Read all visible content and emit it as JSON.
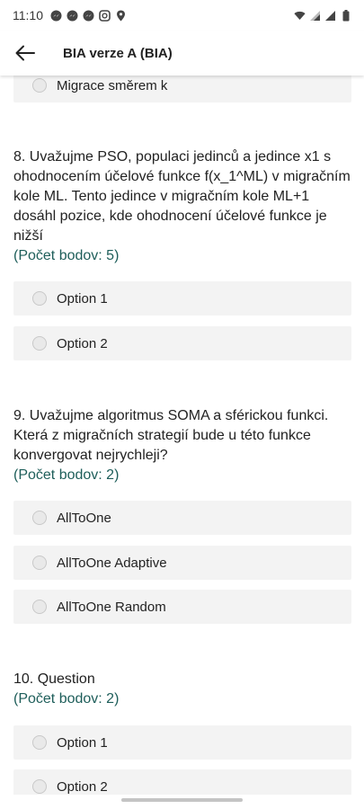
{
  "status": {
    "time": "11:10"
  },
  "app_bar": {
    "title": "BIA verze A (BIA)"
  },
  "partial_option": {
    "label": "Migrace směrem k"
  },
  "questions": [
    {
      "text": "8. Uvažujme PSO, populaci jedinců a jedince x1 s ohodnocením účelové funkce f(x_1^ML) v migračním kole ML. Tento jedince v migračním kole ML+1 dosáhl pozice, kde ohodnocení účelové funkce je nižší",
      "points": "(Počet bodov: 5)",
      "options": [
        "Option 1",
        "Option 2"
      ]
    },
    {
      "text": "9. Uvažujme algoritmus SOMA a sférickou funkci. Která z migračních strategií bude u této funkce konvergovat nejrychleji?",
      "points": "(Počet bodov: 2)",
      "options": [
        "AllToOne",
        "AllToOne Adaptive",
        "AllToOne Random"
      ]
    },
    {
      "text": "10. Question",
      "points": "(Počet bodov: 2)",
      "options": [
        "Option 1",
        "Option 2"
      ]
    }
  ]
}
